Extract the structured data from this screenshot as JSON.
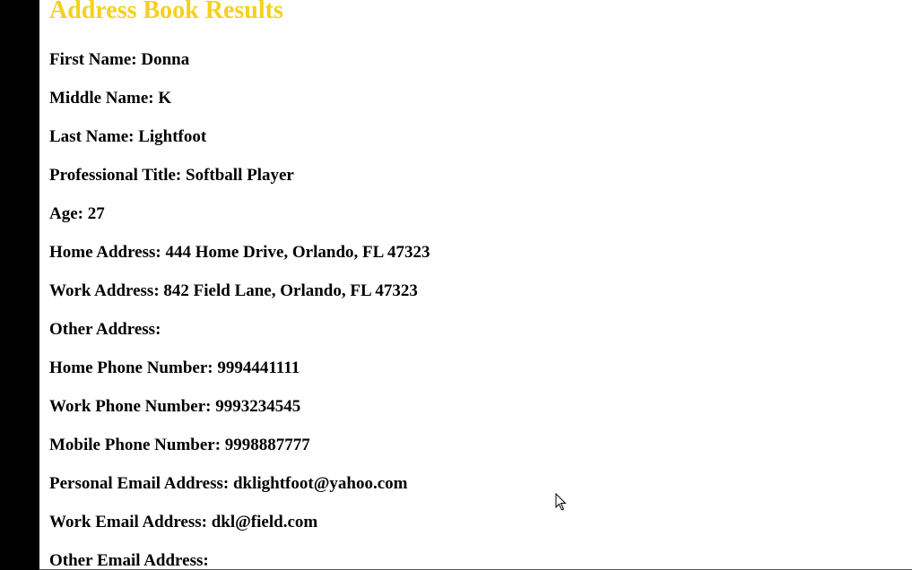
{
  "page": {
    "title": "Address Book Results",
    "title_color": "#f5d01e"
  },
  "fields": [
    {
      "label": "First Name:",
      "value": "Donna"
    },
    {
      "label": "Middle Name:",
      "value": "K"
    },
    {
      "label": "Last Name:",
      "value": "Lightfoot"
    },
    {
      "label": "Professional Title:",
      "value": "Softball Player"
    },
    {
      "label": "Age:",
      "value": "27"
    },
    {
      "label": "Home Address:",
      "value": "444 Home Drive, Orlando, FL 47323"
    },
    {
      "label": "Work Address:",
      "value": "842 Field Lane, Orlando, FL 47323"
    },
    {
      "label": "Other Address:",
      "value": ""
    },
    {
      "label": "Home Phone Number:",
      "value": "9994441111"
    },
    {
      "label": "Work Phone Number:",
      "value": "9993234545"
    },
    {
      "label": "Mobile Phone Number:",
      "value": "9998887777"
    },
    {
      "label": "Personal Email Address:",
      "value": "dklightfoot@yahoo.com"
    },
    {
      "label": "Work Email Address:",
      "value": "dkl@field.com"
    },
    {
      "label": "Other Email Address:",
      "value": ""
    }
  ],
  "icons": {
    "cursor": "mouse-pointer-icon"
  }
}
